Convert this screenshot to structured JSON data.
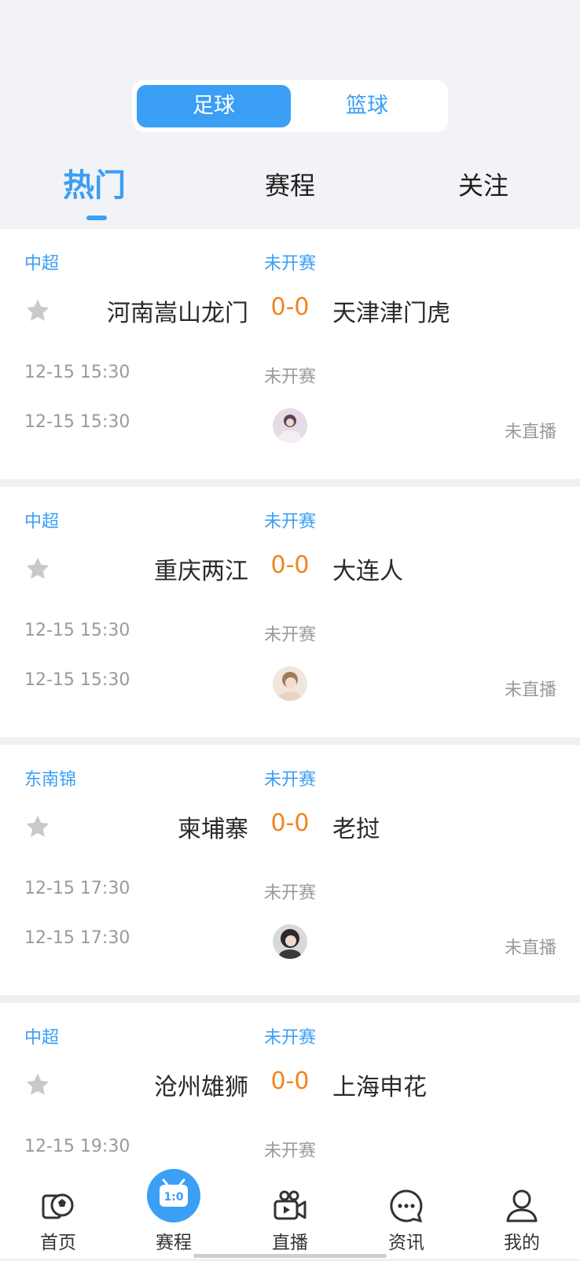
{
  "sport_toggle": {
    "active": "足球",
    "inactive": "篮球"
  },
  "tabs": [
    "热门",
    "赛程",
    "关注"
  ],
  "matches": [
    {
      "league": "中超",
      "status": "未开赛",
      "home": "河南嵩山龙门",
      "score": "0-0",
      "away": "天津津门虎",
      "time1": "12-15 15:30",
      "status2": "未开赛",
      "time2": "12-15 15:30",
      "live": "未直播"
    },
    {
      "league": "中超",
      "status": "未开赛",
      "home": "重庆两江",
      "score": "0-0",
      "away": "大连人",
      "time1": "12-15 15:30",
      "status2": "未开赛",
      "time2": "12-15 15:30",
      "live": "未直播"
    },
    {
      "league": "东南锦",
      "status": "未开赛",
      "home": "柬埔寨",
      "score": "0-0",
      "away": "老挝",
      "time1": "12-15 17:30",
      "status2": "未开赛",
      "time2": "12-15 17:30",
      "live": "未直播"
    },
    {
      "league": "中超",
      "status": "未开赛",
      "home": "沧州雄狮",
      "score": "0-0",
      "away": "上海申花",
      "time1": "12-15 19:30",
      "status2": "未开赛",
      "time2": "",
      "live": ""
    }
  ],
  "nav": [
    "首页",
    "赛程",
    "直播",
    "资讯",
    "我的"
  ],
  "nav_center_badge": "1:0",
  "colors": {
    "accent": "#3a9ff5",
    "score": "#f0841f",
    "muted": "#9a9a9a"
  }
}
